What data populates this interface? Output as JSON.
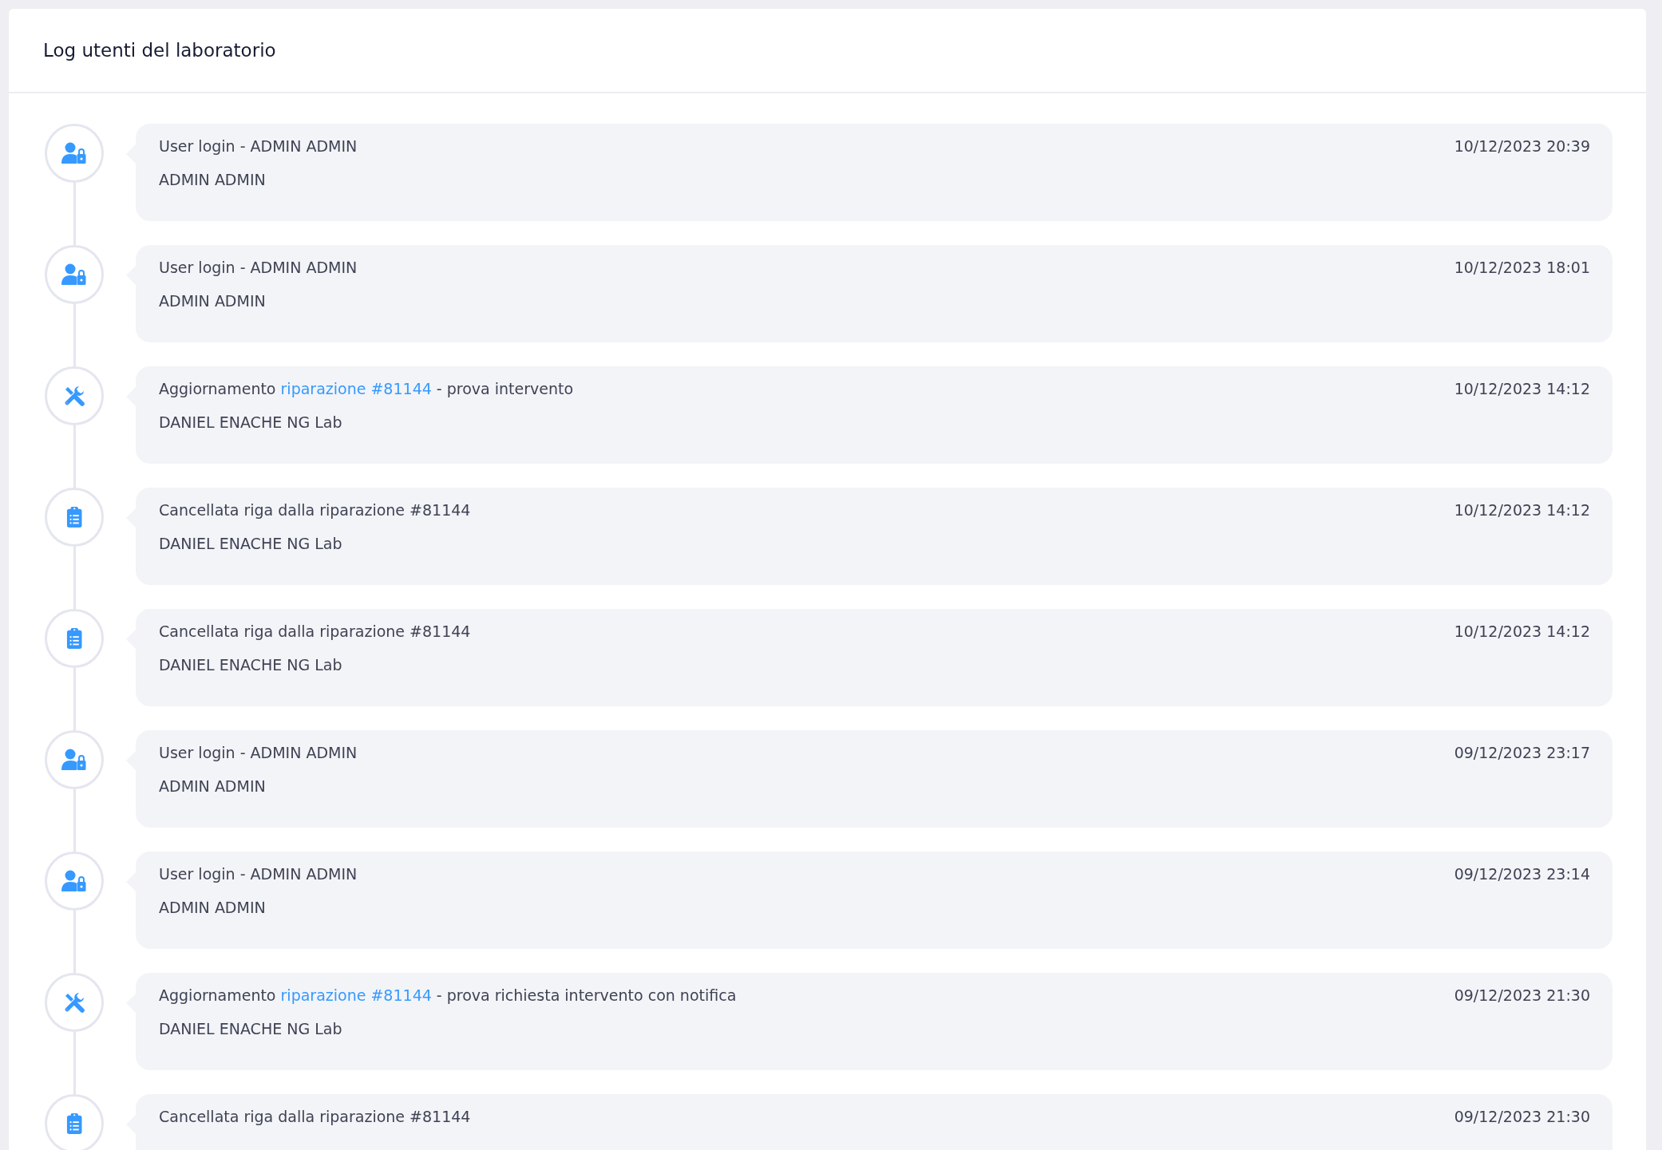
{
  "card": {
    "title": "Log utenti del laboratorio"
  },
  "timeline": [
    {
      "kind": "login",
      "message": {
        "before": "User login - ADMIN ADMIN"
      },
      "date": "10/12/2023 20:39",
      "author": "ADMIN ADMIN"
    },
    {
      "kind": "login",
      "message": {
        "before": "User login - ADMIN ADMIN"
      },
      "date": "10/12/2023 18:01",
      "author": "ADMIN ADMIN"
    },
    {
      "kind": "repair",
      "message": {
        "before": "Aggiornamento ",
        "link": "riparazione #81144",
        "after": " - prova intervento"
      },
      "date": "10/12/2023 14:12",
      "author": "DANIEL ENACHE NG Lab"
    },
    {
      "kind": "list",
      "message": {
        "before": "Cancellata riga dalla riparazione #81144"
      },
      "date": "10/12/2023 14:12",
      "author": "DANIEL ENACHE NG Lab"
    },
    {
      "kind": "list",
      "message": {
        "before": "Cancellata riga dalla riparazione #81144"
      },
      "date": "10/12/2023 14:12",
      "author": "DANIEL ENACHE NG Lab"
    },
    {
      "kind": "login",
      "message": {
        "before": "User login - ADMIN ADMIN"
      },
      "date": "09/12/2023 23:17",
      "author": "ADMIN ADMIN"
    },
    {
      "kind": "login",
      "message": {
        "before": "User login - ADMIN ADMIN"
      },
      "date": "09/12/2023 23:14",
      "author": "ADMIN ADMIN"
    },
    {
      "kind": "repair",
      "message": {
        "before": "Aggiornamento ",
        "link": "riparazione #81144",
        "after": " - prova richiesta intervento con notifica"
      },
      "date": "09/12/2023 21:30",
      "author": "DANIEL ENACHE NG Lab"
    },
    {
      "kind": "list",
      "message": {
        "before": "Cancellata riga dalla riparazione #81144"
      },
      "date": "09/12/2023 21:30"
    }
  ]
}
